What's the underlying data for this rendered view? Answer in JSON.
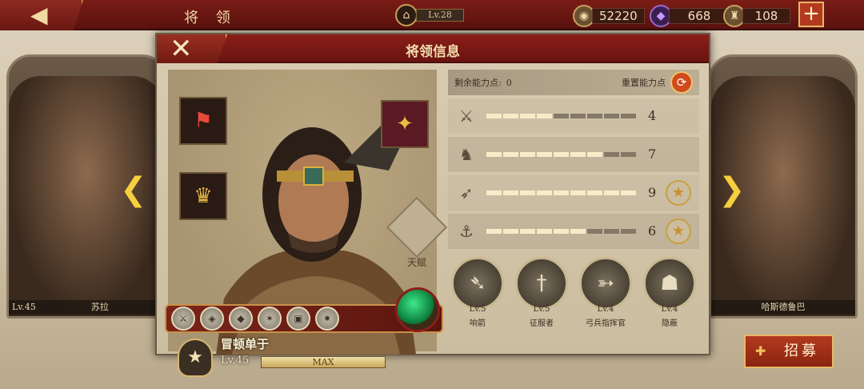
{
  "topbar": {
    "back_icon": "◀",
    "title": "将 领",
    "level": "Lv.28",
    "coins": "52220",
    "gems": "668",
    "helmets": "108",
    "plus": "+"
  },
  "side_heroes": {
    "left": {
      "level": "Lv.45",
      "name": "苏拉"
    },
    "right": {
      "name": "哈斯德鲁巴"
    }
  },
  "recruit": {
    "label": "招募",
    "icon": "✚"
  },
  "panel": {
    "title": "将领信息",
    "close": "✕",
    "talent_label": "天赋",
    "hero": {
      "name": "冒顿单于",
      "level": "Lv.45",
      "xp_label": "MAX",
      "rank_icon": "★"
    },
    "skill_icons": [
      "⚔",
      "◈",
      "◆",
      "✶",
      "▣",
      "✷"
    ],
    "ability": {
      "remaining_label": "剩余能力点:",
      "remaining_value": "0",
      "reset_label": "重置能力点",
      "reset_icon": "⟳"
    },
    "stats": [
      {
        "icon": "⚔",
        "value": "4",
        "filled": 4,
        "badge": ""
      },
      {
        "icon": "♞",
        "value": "7",
        "filled": 7,
        "badge": ""
      },
      {
        "icon": "➶",
        "value": "9",
        "filled": 9,
        "badge": "★"
      },
      {
        "icon": "⚓",
        "value": "6",
        "filled": 6,
        "badge": "★"
      }
    ],
    "skills": [
      {
        "icon": "➴",
        "level": "Lv.5",
        "name": "响箭"
      },
      {
        "icon": "†",
        "level": "Lv.5",
        "name": "征服者"
      },
      {
        "icon": "➳",
        "level": "Lv.4",
        "name": "弓兵指挥官"
      },
      {
        "icon": "☗",
        "level": "Lv.4",
        "name": "隐蔽"
      }
    ]
  },
  "colors": {
    "accent": "#7a1c16",
    "gold": "#e8b868",
    "gem_green": "#0a7a3a"
  }
}
